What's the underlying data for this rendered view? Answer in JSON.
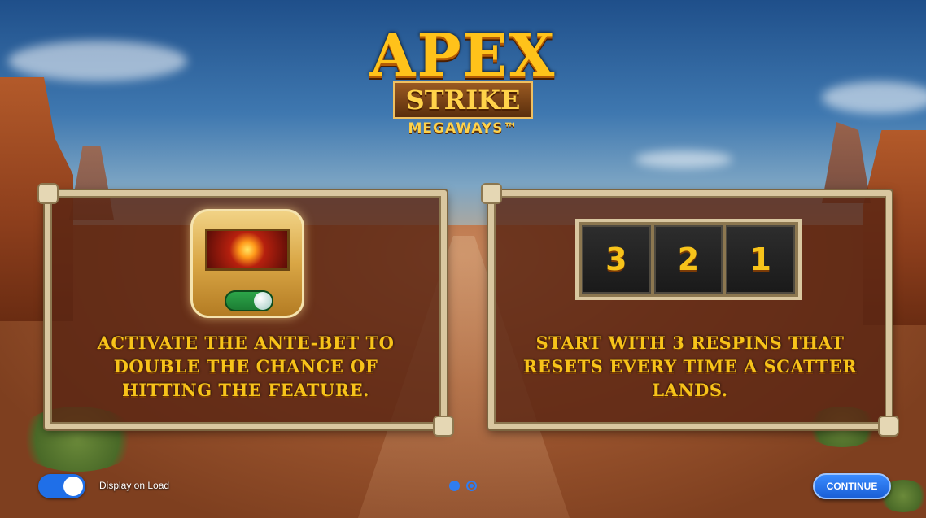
{
  "logo": {
    "title": "APEX",
    "subtitle": "STRIKE",
    "tagline": "MEGAWAYS™"
  },
  "panels": [
    {
      "text": "ACTIVATE THE ANTE-BET TO DOUBLE THE CHANCE OF HITTING THE FEATURE.",
      "icon": "ante-bet-toggle-icon"
    },
    {
      "text": "START WITH 3 RESPINS THAT RESETS EVERY TIME A SCATTER LANDS.",
      "respin_counter": [
        "3",
        "2",
        "1"
      ]
    }
  ],
  "footer": {
    "display_on_load_label": "Display on Load",
    "display_on_load_enabled": true,
    "continue_label": "CONTINUE",
    "page_count": 2,
    "current_page": 1
  },
  "colors": {
    "accent_blue": "#2f7df0",
    "text_gold": "#f7c31a",
    "frame": "#d9c7a0"
  }
}
